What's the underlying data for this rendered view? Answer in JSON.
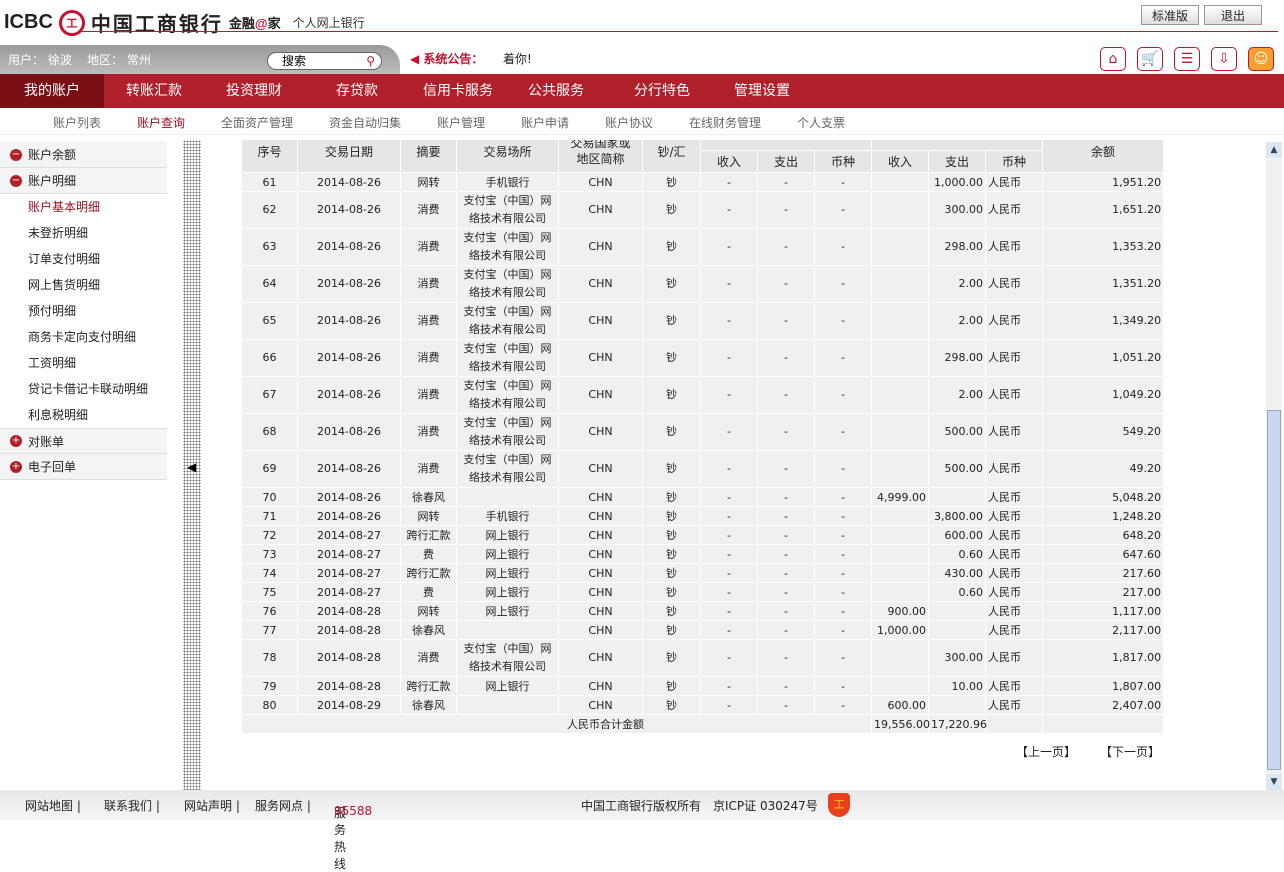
{
  "header": {
    "logo_text": "ICBC",
    "bank_name": "中国工商银行",
    "slogan_a": "金融",
    "slogan_at": "@",
    "slogan_b": "家",
    "subtitle": "个人网上银行",
    "btn_standard": "标准版",
    "btn_logout": "退出"
  },
  "userbar": {
    "user": "用户： 徐波",
    "region": "地区： 常州",
    "search_placeholder": "搜索",
    "notice_label": "系统公告：",
    "notice_text": "着你!"
  },
  "nav": [
    "我的账户",
    "转账汇款",
    "投资理财",
    "存贷款",
    "信用卡服务",
    "公共服务",
    "分行特色",
    "管理设置"
  ],
  "subnav": [
    "账户列表",
    "账户查询",
    "全面资产管理",
    "资金自动归集",
    "账户管理",
    "账户申请",
    "账户协议",
    "在线财务管理",
    "个人支票"
  ],
  "sidebar": {
    "groups": [
      "账户余额",
      "账户明细",
      "对账单",
      "电子回单"
    ],
    "items": [
      "账户基本明细",
      "未登折明细",
      "订单支付明细",
      "网上售货明细",
      "预付明细",
      "商务卡定向支付明细",
      "工资明细",
      "贷记卡借记卡联动明细",
      "利息税明细"
    ]
  },
  "table": {
    "headers": {
      "seq": "序号",
      "date": "交易日期",
      "summary": "摘要",
      "place": "交易场所",
      "region_a": "交易国家或",
      "region_b": "地区简称",
      "cash": "钞/汇",
      "in": "收入",
      "out": "支出",
      "cur": "币种",
      "balance": "余额"
    },
    "rows": [
      [
        "61",
        "2014-08-26",
        "网转",
        "手机银行",
        "CHN",
        "钞",
        "-",
        "-",
        "-",
        "",
        "1,000.00",
        "人民币",
        "1,951.20"
      ],
      [
        "62",
        "2014-08-26",
        "消费",
        "支付宝（中国）网络技术有限公司",
        "CHN",
        "钞",
        "-",
        "-",
        "-",
        "",
        "300.00",
        "人民币",
        "1,651.20"
      ],
      [
        "63",
        "2014-08-26",
        "消费",
        "支付宝（中国）网络技术有限公司",
        "CHN",
        "钞",
        "-",
        "-",
        "-",
        "",
        "298.00",
        "人民币",
        "1,353.20"
      ],
      [
        "64",
        "2014-08-26",
        "消费",
        "支付宝（中国）网络技术有限公司",
        "CHN",
        "钞",
        "-",
        "-",
        "-",
        "",
        "2.00",
        "人民币",
        "1,351.20"
      ],
      [
        "65",
        "2014-08-26",
        "消费",
        "支付宝（中国）网络技术有限公司",
        "CHN",
        "钞",
        "-",
        "-",
        "-",
        "",
        "2.00",
        "人民币",
        "1,349.20"
      ],
      [
        "66",
        "2014-08-26",
        "消费",
        "支付宝（中国）网络技术有限公司",
        "CHN",
        "钞",
        "-",
        "-",
        "-",
        "",
        "298.00",
        "人民币",
        "1,051.20"
      ],
      [
        "67",
        "2014-08-26",
        "消费",
        "支付宝（中国）网络技术有限公司",
        "CHN",
        "钞",
        "-",
        "-",
        "-",
        "",
        "2.00",
        "人民币",
        "1,049.20"
      ],
      [
        "68",
        "2014-08-26",
        "消费",
        "支付宝（中国）网络技术有限公司",
        "CHN",
        "钞",
        "-",
        "-",
        "-",
        "",
        "500.00",
        "人民币",
        "549.20"
      ],
      [
        "69",
        "2014-08-26",
        "消费",
        "支付宝（中国）网络技术有限公司",
        "CHN",
        "钞",
        "-",
        "-",
        "-",
        "",
        "500.00",
        "人民币",
        "49.20"
      ],
      [
        "70",
        "2014-08-26",
        "徐春风",
        "",
        "CHN",
        "钞",
        "-",
        "-",
        "-",
        "4,999.00",
        "",
        "人民币",
        "5,048.20"
      ],
      [
        "71",
        "2014-08-26",
        "网转",
        "手机银行",
        "CHN",
        "钞",
        "-",
        "-",
        "-",
        "",
        "3,800.00",
        "人民币",
        "1,248.20"
      ],
      [
        "72",
        "2014-08-27",
        "跨行汇款",
        "网上银行",
        "CHN",
        "钞",
        "-",
        "-",
        "-",
        "",
        "600.00",
        "人民币",
        "648.20"
      ],
      [
        "73",
        "2014-08-27",
        "费",
        "网上银行",
        "CHN",
        "钞",
        "-",
        "-",
        "-",
        "",
        "0.60",
        "人民币",
        "647.60"
      ],
      [
        "74",
        "2014-08-27",
        "跨行汇款",
        "网上银行",
        "CHN",
        "钞",
        "-",
        "-",
        "-",
        "",
        "430.00",
        "人民币",
        "217.60"
      ],
      [
        "75",
        "2014-08-27",
        "费",
        "网上银行",
        "CHN",
        "钞",
        "-",
        "-",
        "-",
        "",
        "0.60",
        "人民币",
        "217.00"
      ],
      [
        "76",
        "2014-08-28",
        "网转",
        "网上银行",
        "CHN",
        "钞",
        "-",
        "-",
        "-",
        "900.00",
        "",
        "人民币",
        "1,117.00"
      ],
      [
        "77",
        "2014-08-28",
        "徐春风",
        "",
        "CHN",
        "钞",
        "-",
        "-",
        "-",
        "1,000.00",
        "",
        "人民币",
        "2,117.00"
      ],
      [
        "78",
        "2014-08-28",
        "消费",
        "支付宝（中国）网络技术有限公司",
        "CHN",
        "钞",
        "-",
        "-",
        "-",
        "",
        "300.00",
        "人民币",
        "1,817.00"
      ],
      [
        "79",
        "2014-08-28",
        "跨行汇款",
        "网上银行",
        "CHN",
        "钞",
        "-",
        "-",
        "-",
        "",
        "10.00",
        "人民币",
        "1,807.00"
      ],
      [
        "80",
        "2014-08-29",
        "徐春风",
        "",
        "CHN",
        "钞",
        "-",
        "-",
        "-",
        "600.00",
        "",
        "人民币",
        "2,407.00"
      ]
    ],
    "total_label": "人民币合计金额",
    "total_in": "19,556.00",
    "total_out": "17,220.96"
  },
  "pager": {
    "prev": "【上一页】",
    "next": "【下一页】"
  },
  "footer": {
    "links": [
      "网站地图 |",
      "联系我们 |",
      "网站声明 |",
      "服务网点 |"
    ],
    "hotline_label": "服务热线",
    "hotline": "95588",
    "copyright": "中国工商银行版权所有",
    "icp": "京ICP证 030247号"
  }
}
